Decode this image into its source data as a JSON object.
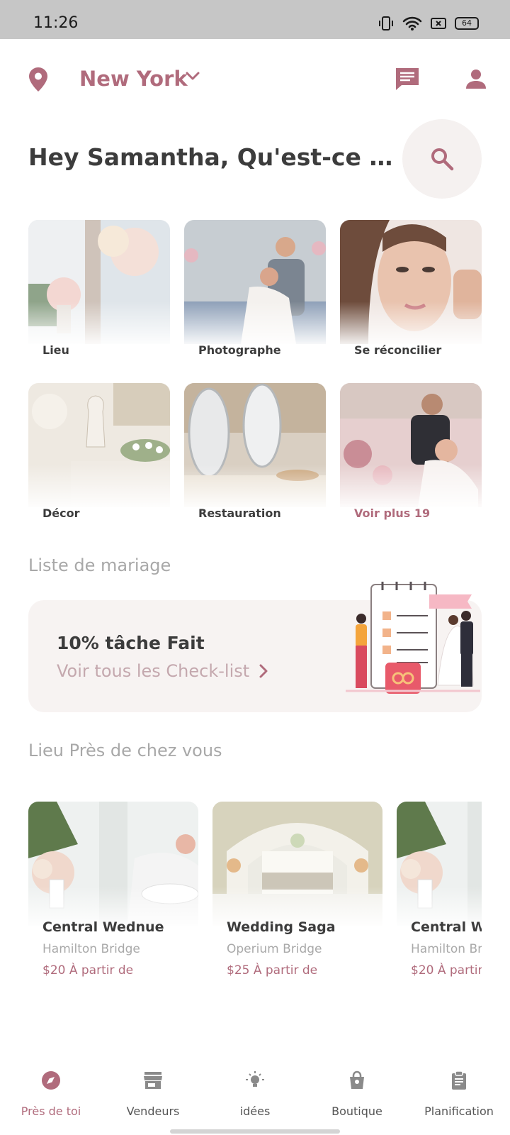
{
  "status_bar": {
    "time": "11:26",
    "battery": "64"
  },
  "header": {
    "city": "New York"
  },
  "greeting": "Hey Samantha, Qu'est-ce qu...",
  "categories": [
    {
      "label": "Lieu"
    },
    {
      "label": "Photographe"
    },
    {
      "label": "Se réconcilier"
    },
    {
      "label": "Décor"
    },
    {
      "label": "Restauration"
    },
    {
      "label": "Voir plus 19"
    }
  ],
  "checklist": {
    "section_title": "Liste de mariage",
    "progress_text": "10% tâche Fait",
    "link_label": "Voir tous les Check-list"
  },
  "nearby": {
    "section_title": "Lieu Près de chez vous",
    "venues": [
      {
        "name": "Central Wednue",
        "area": "Hamilton Bridge",
        "price": "$20 À partir de"
      },
      {
        "name": "Wedding Saga",
        "area": "Operium Bridge",
        "price": "$25 À partir de"
      },
      {
        "name": "Central W",
        "area": "Hamilton Br",
        "price": "$20 À partir"
      }
    ]
  },
  "bottom_nav": [
    {
      "label": "Près de toi",
      "icon": "compass-icon",
      "active": true
    },
    {
      "label": "Vendeurs",
      "icon": "store-icon",
      "active": false
    },
    {
      "label": "idées",
      "icon": "lightbulb-icon",
      "active": false
    },
    {
      "label": "Boutique",
      "icon": "shopping-bag-icon",
      "active": false
    },
    {
      "label": "Planification",
      "icon": "clipboard-icon",
      "active": false
    }
  ],
  "colors": {
    "accent": "#b06b7c",
    "card_bg": "#f7f3f2",
    "muted": "#a8a8a8"
  }
}
